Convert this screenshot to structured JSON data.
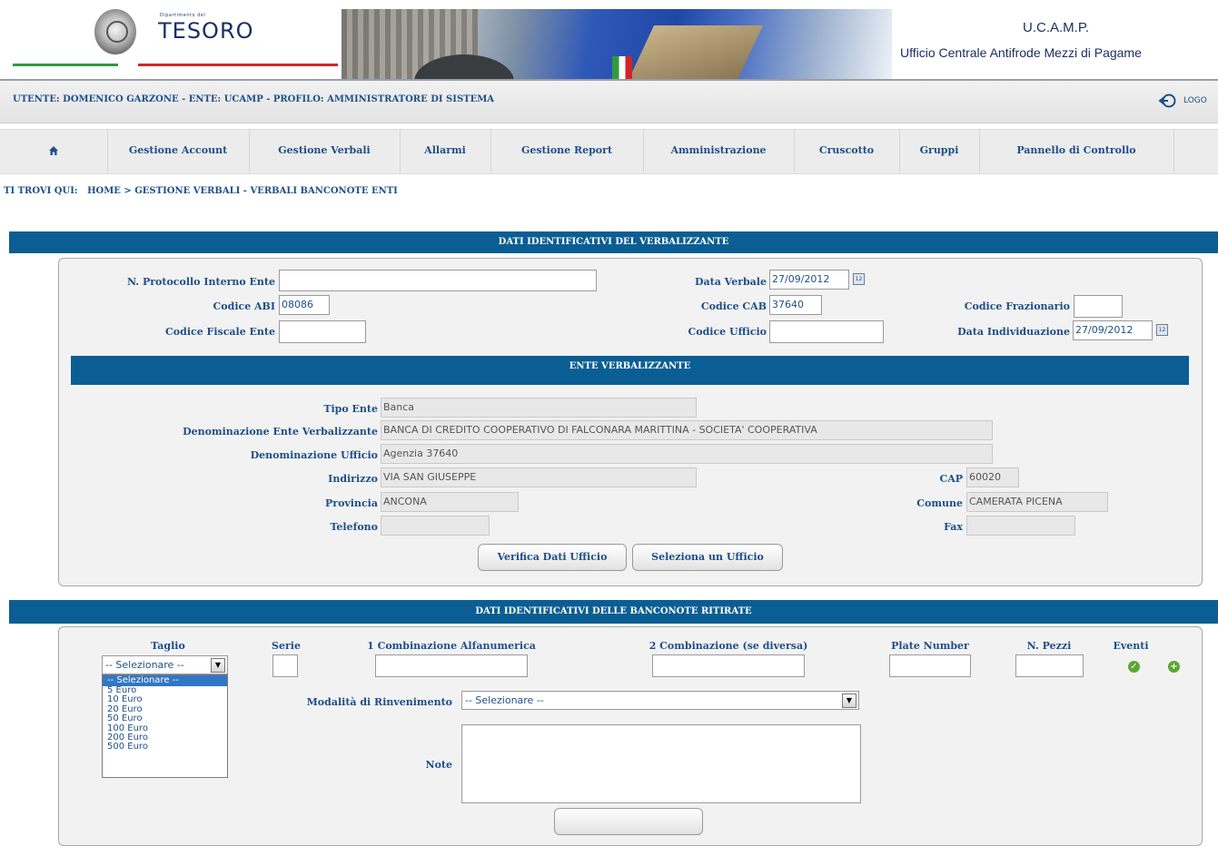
{
  "header": {
    "dept_small": "Dipartimento del",
    "logo_text": "TESORO",
    "org_short": "U.C.A.M.P.",
    "org_full": "Ufficio Centrale Antifrode Mezzi di Pagame"
  },
  "userbar": {
    "info": "UTENTE: DOMENICO GARZONE - ENTE: UCAMP - PROFILO: AMMINISTRATORE DI SISTEMA",
    "logout": "LOGO"
  },
  "nav": {
    "home_icon": "home-icon",
    "items": [
      "Gestione Account",
      "Gestione Verbali",
      "Allarmi",
      "Gestione Report",
      "Amministrazione",
      "Cruscotto",
      "Gruppi",
      "Pannello di Controllo"
    ]
  },
  "breadcrumb": {
    "label": "TI TROVI QUI:",
    "path": "HOME > GESTIONE VERBALI - VERBALI BANCONOTE ENTI"
  },
  "verbalizzante": {
    "title": "DATI IDENTIFICATIVI DEL VERBALIZZANTE",
    "protocollo_label": "N. Protocollo Interno Ente",
    "protocollo_value": "",
    "data_verbale_label": "Data Verbale",
    "data_verbale_value": "27/09/2012",
    "abi_label": "Codice ABI",
    "abi_value": "08086",
    "cab_label": "Codice CAB",
    "cab_value": "37640",
    "frazionario_label": "Codice Frazionario",
    "frazionario_value": "",
    "fiscale_label": "Codice Fiscale Ente",
    "fiscale_value": "",
    "ufficio_label": "Codice Ufficio",
    "ufficio_value": "",
    "individuazione_label": "Data Individuazione",
    "individuazione_value": "27/09/2012",
    "cal_icon": "calendar-icon"
  },
  "ente": {
    "title": "ENTE VERBALIZZANTE",
    "tipo_label": "Tipo Ente",
    "tipo_value": "Banca",
    "denominazione_label": "Denominazione Ente Verbalizzante",
    "denominazione_value": "BANCA DI CREDITO COOPERATIVO DI FALCONARA MARITTINA - SOCIETA' COOPERATIVA",
    "den_ufficio_label": "Denominazione Ufficio",
    "den_ufficio_value": "Agenzia 37640",
    "indirizzo_label": "Indirizzo",
    "indirizzo_value": "VIA SAN GIUSEPPE",
    "cap_label": "CAP",
    "cap_value": "60020",
    "provincia_label": "Provincia",
    "provincia_value": "ANCONA",
    "comune_label": "Comune",
    "comune_value": "CAMERATA PICENA",
    "telefono_label": "Telefono",
    "telefono_value": "",
    "fax_label": "Fax",
    "fax_value": "",
    "btn_verifica": "Verifica Dati Ufficio",
    "btn_seleziona": "Seleziona un Ufficio"
  },
  "banconote": {
    "title": "DATI IDENTIFICATIVI DELLE BANCONOTE RITIRATE",
    "taglio_label": "Taglio",
    "serie_label": "Serie",
    "comb1_label": "1 Combinazione Alfanumerica",
    "comb2_label": "2 Combinazione (se diversa)",
    "plate_label": "Plate Number",
    "pezzi_label": "N. Pezzi",
    "eventi_label": "Eventi",
    "taglio_selected": "-- Selezionare --",
    "taglio_options": [
      "-- Selezionare --",
      "5 Euro",
      "10 Euro",
      "20 Euro",
      "50 Euro",
      "100 Euro",
      "200 Euro",
      "500 Euro"
    ],
    "modalita_label": "Modalità di Rinvenimento",
    "modalita_selected": "-- Selezionare --",
    "note_label": "Note",
    "note_value": "",
    "ev_ok_icon": "check-circle-icon",
    "ev_add_icon": "plus-circle-icon"
  },
  "colors": {
    "brand_blue": "#0a5e93",
    "link_blue": "#1e4f88"
  }
}
